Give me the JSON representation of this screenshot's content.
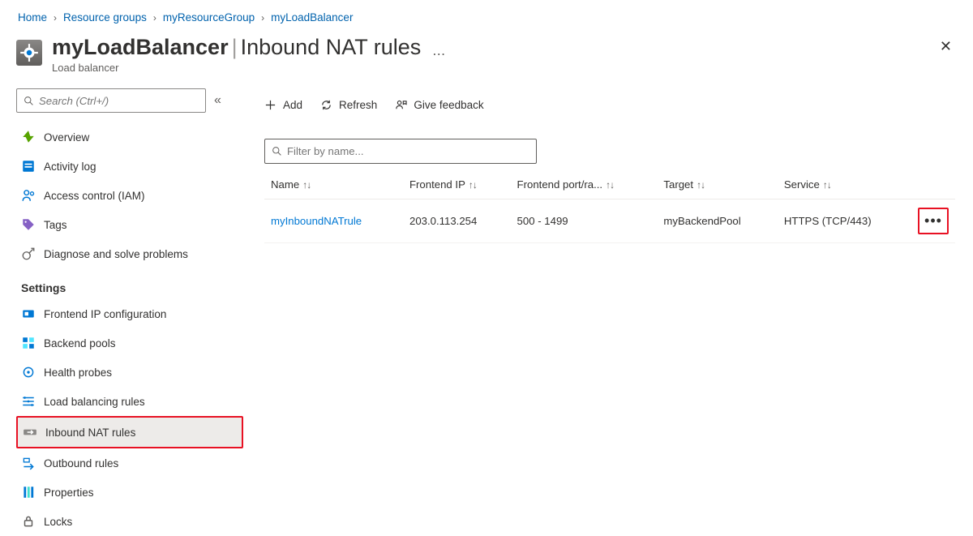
{
  "breadcrumb": [
    "Home",
    "Resource groups",
    "myResourceGroup",
    "myLoadBalancer"
  ],
  "header": {
    "title": "myLoadBalancer",
    "page": "Inbound NAT rules",
    "subtitle": "Load balancer"
  },
  "sidebar": {
    "search_placeholder": "Search (Ctrl+/)",
    "items_top": [
      {
        "label": "Overview",
        "icon": "overview"
      },
      {
        "label": "Activity log",
        "icon": "activity"
      },
      {
        "label": "Access control (IAM)",
        "icon": "iam"
      },
      {
        "label": "Tags",
        "icon": "tags"
      },
      {
        "label": "Diagnose and solve problems",
        "icon": "diagnose"
      }
    ],
    "section": "Settings",
    "items_settings": [
      {
        "label": "Frontend IP configuration",
        "icon": "frontend"
      },
      {
        "label": "Backend pools",
        "icon": "backend"
      },
      {
        "label": "Health probes",
        "icon": "health"
      },
      {
        "label": "Load balancing rules",
        "icon": "lbrules"
      },
      {
        "label": "Inbound NAT rules",
        "icon": "inbound",
        "selected": true
      },
      {
        "label": "Outbound rules",
        "icon": "outbound"
      },
      {
        "label": "Properties",
        "icon": "props"
      },
      {
        "label": "Locks",
        "icon": "locks"
      }
    ]
  },
  "toolbar": {
    "add": "Add",
    "refresh": "Refresh",
    "feedback": "Give feedback"
  },
  "filter_placeholder": "Filter by name...",
  "table": {
    "headers": [
      "Name",
      "Frontend IP",
      "Frontend port/ra...",
      "Target",
      "Service"
    ],
    "rows": [
      {
        "name": "myInboundNATrule",
        "frontend_ip": "203.0.113.254",
        "port": "500 - 1499",
        "target": "myBackendPool",
        "service": "HTTPS (TCP/443)"
      }
    ]
  }
}
